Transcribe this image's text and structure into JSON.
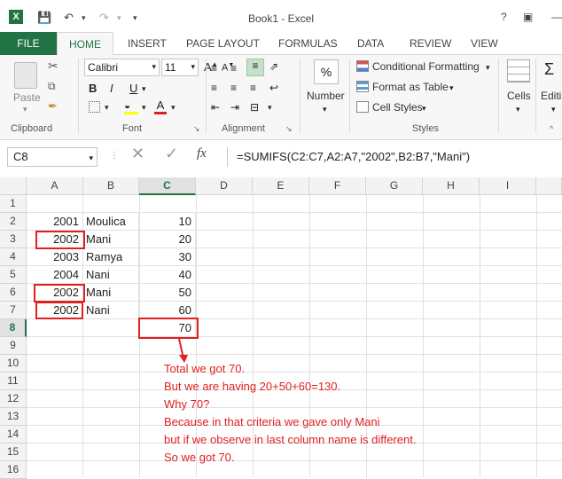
{
  "window": {
    "title": "Book1 - Excel",
    "help": "?"
  },
  "tabs": [
    "FILE",
    "HOME",
    "INSERT",
    "PAGE LAYOUT",
    "FORMULAS",
    "DATA",
    "REVIEW",
    "VIEW"
  ],
  "ribbon": {
    "clipboard": {
      "paste_label": "Paste",
      "group_label": "Clipboard"
    },
    "font": {
      "name": "Calibri",
      "size": "11",
      "bold": "B",
      "italic": "I",
      "underline": "U",
      "group_label": "Font"
    },
    "alignment": {
      "group_label": "Alignment"
    },
    "number": {
      "label": "Number",
      "percent": "%"
    },
    "styles": {
      "conditional": "Conditional Formatting",
      "table": "Format as Table",
      "cell_styles": "Cell Styles",
      "group_label": "Styles"
    },
    "cells": {
      "label": "Cells"
    },
    "editing": {
      "label": "Editi"
    }
  },
  "formula_bar": {
    "name_box": "C8",
    "fx": "fx",
    "formula": "=SUMIFS(C2:C7,A2:A7,\"2002\",B2:B7,\"Mani\")"
  },
  "columns": [
    "A",
    "B",
    "C",
    "D",
    "E",
    "F",
    "G",
    "H",
    "I"
  ],
  "rows": [
    "1",
    "2",
    "3",
    "4",
    "5",
    "6",
    "7",
    "8",
    "9",
    "10",
    "11",
    "12",
    "13",
    "14",
    "15",
    "16"
  ],
  "sheet": {
    "a": [
      "",
      "2001",
      "2002",
      "2003",
      "2004",
      "2002",
      "2002",
      ""
    ],
    "b": [
      "",
      "Moulica",
      "Mani",
      "Ramya",
      "Nani",
      "Mani",
      "Nani",
      ""
    ],
    "c": [
      "",
      "10",
      "20",
      "30",
      "40",
      "50",
      "60",
      "70"
    ]
  },
  "notes": [
    "Total we got 70.",
    "But we are having 20+50+60=130.",
    "Why 70?",
    "Because in that criteria we gave only Mani",
    "but if we observe in last column name is different.",
    "So we got 70."
  ],
  "colors": {
    "excel_green": "#217346",
    "annotation_red": "#e02020"
  }
}
